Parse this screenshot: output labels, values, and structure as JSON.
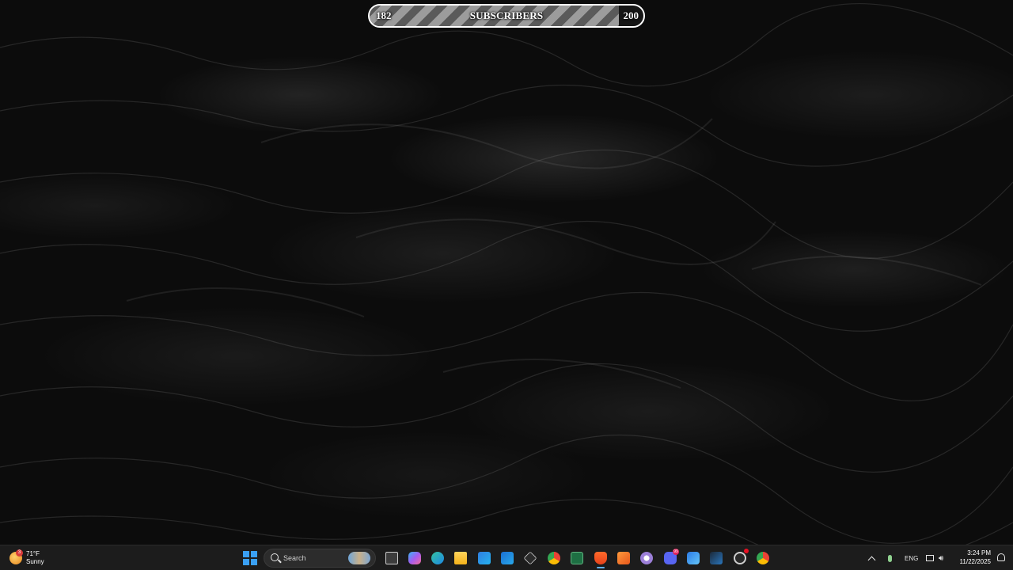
{
  "subscriber_goal": {
    "current": "182",
    "label": "SUBSCRIBERS",
    "goal": "200",
    "progress_fraction": 0.91
  },
  "taskbar": {
    "weather": {
      "temperature": "71°F",
      "condition": "Sunny",
      "badge": "3",
      "icon": "sun-icon"
    },
    "search": {
      "placeholder": "Search"
    },
    "apps": [
      {
        "name": "task-view",
        "icon": "task-view-icon"
      },
      {
        "name": "copilot",
        "icon": "copilot-icon"
      },
      {
        "name": "edge",
        "icon": "edge-icon"
      },
      {
        "name": "file-explorer",
        "icon": "folder-icon"
      },
      {
        "name": "microsoft-store",
        "icon": "store-icon"
      },
      {
        "name": "outlook",
        "icon": "outlook-icon"
      },
      {
        "name": "unity",
        "icon": "unity-icon"
      },
      {
        "name": "chrome",
        "icon": "chrome-icon"
      },
      {
        "name": "excel",
        "icon": "excel-icon"
      },
      {
        "name": "brave",
        "icon": "brave-icon"
      },
      {
        "name": "adobe-app",
        "icon": "adobe-icon"
      },
      {
        "name": "obs",
        "icon": "obs-icon"
      },
      {
        "name": "discord",
        "icon": "discord-icon",
        "badge": "99"
      },
      {
        "name": "app-installer",
        "icon": "installer-icon"
      },
      {
        "name": "steam",
        "icon": "steam-icon"
      },
      {
        "name": "recorder",
        "icon": "recorder-icon"
      },
      {
        "name": "chrome-profile",
        "icon": "chrome-icon"
      }
    ],
    "tray": {
      "language": "ENG",
      "time": "3:24 PM",
      "date": "11/22/2025"
    }
  },
  "colors": {
    "accent": "#3aa0f4",
    "taskbar_bg": "#1c1c1c",
    "progress_stripe_dark": "#5a5a5a",
    "progress_stripe_light": "#9c9c9c"
  }
}
